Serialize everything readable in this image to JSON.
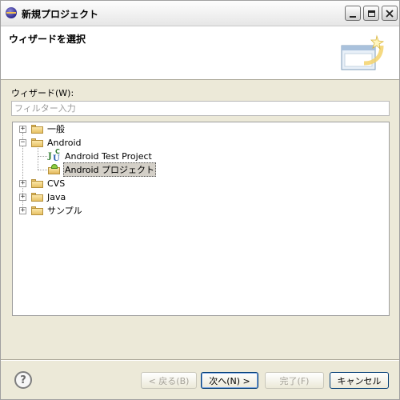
{
  "window": {
    "title": "新規プロジェクト",
    "controls": {
      "minimize": "_",
      "maximize": "□",
      "close": "×"
    }
  },
  "banner": {
    "title": "ウィザードを選択"
  },
  "wizards_label": "ウィザード(W):",
  "filter": {
    "placeholder": "フィルター入力",
    "value": ""
  },
  "tree": {
    "items": [
      {
        "label": "一般",
        "expander": "+",
        "icon": "folder-icon"
      },
      {
        "label": "Android",
        "expander": "−",
        "icon": "folder-icon",
        "children": [
          {
            "label": "Android Test Project",
            "icon": "junit-test-icon"
          },
          {
            "label": "Android プロジェクト",
            "icon": "android-project-icon",
            "selected": true
          }
        ]
      },
      {
        "label": "CVS",
        "expander": "+",
        "icon": "folder-icon"
      },
      {
        "label": "Java",
        "expander": "+",
        "icon": "folder-icon"
      },
      {
        "label": "サンプル",
        "expander": "+",
        "icon": "folder-icon"
      }
    ]
  },
  "buttons": {
    "help": "?",
    "back": "< 戻る(B)",
    "next": "次へ(N) >",
    "finish": "完了(F)",
    "cancel": "キャンセル"
  }
}
